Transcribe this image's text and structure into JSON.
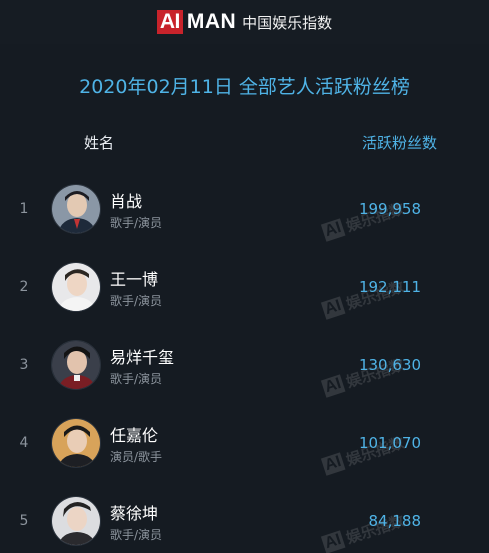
{
  "header": {
    "logo_ai": "AI",
    "logo_man": "MAN",
    "logo_subtitle": "中国娱乐指数"
  },
  "title": "2020年02月11日 全部艺人活跃粉丝榜",
  "columns": {
    "name": "姓名",
    "fans": "活跃粉丝数"
  },
  "watermark": {
    "ai": "AI",
    "text": "娱乐指数"
  },
  "colors": {
    "accent": "#4fb3e6",
    "brand_red": "#c8232b",
    "background": "#151b22"
  },
  "rows": [
    {
      "rank": "1",
      "name": "肖战",
      "role": "歌手/演员",
      "value": "199,958",
      "avatar_icon": "artist-avatar-icon"
    },
    {
      "rank": "2",
      "name": "王一博",
      "role": "歌手/演员",
      "value": "192,111",
      "avatar_icon": "artist-avatar-icon"
    },
    {
      "rank": "3",
      "name": "易烊千玺",
      "role": "歌手/演员",
      "value": "130,630",
      "avatar_icon": "artist-avatar-icon"
    },
    {
      "rank": "4",
      "name": "任嘉伦",
      "role": "演员/歌手",
      "value": "101,070",
      "avatar_icon": "artist-avatar-icon"
    },
    {
      "rank": "5",
      "name": "蔡徐坤",
      "role": "歌手/演员",
      "value": "84,188",
      "avatar_icon": "artist-avatar-icon"
    }
  ]
}
